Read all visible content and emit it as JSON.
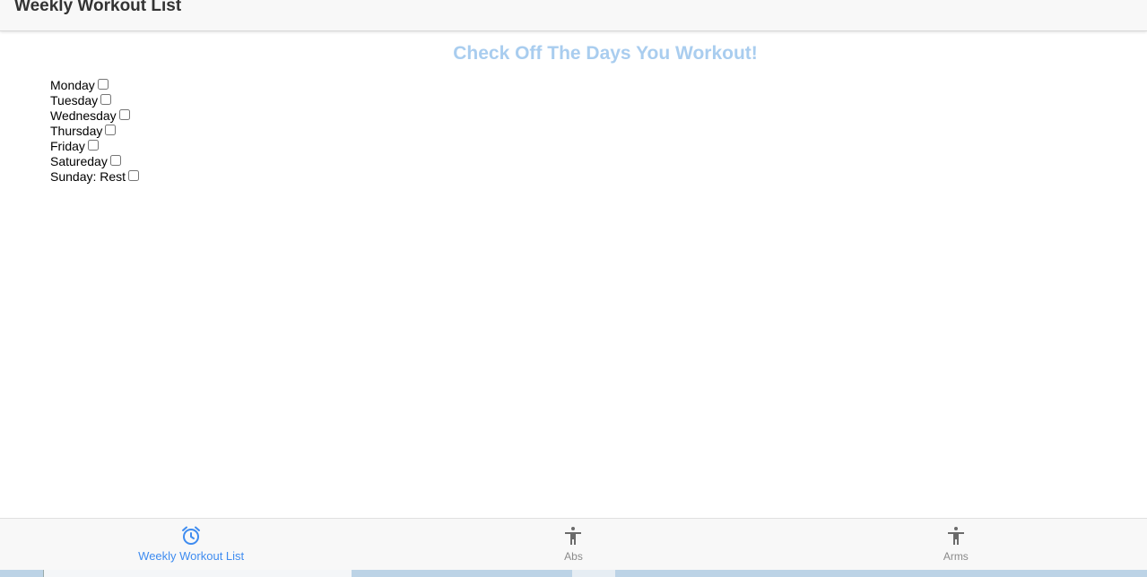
{
  "header": {
    "title": "Weekly Workout List"
  },
  "main": {
    "heading": "Check Off The Days You Workout!",
    "days": [
      {
        "label": "Monday",
        "checked": false
      },
      {
        "label": "Tuesday",
        "checked": false
      },
      {
        "label": "Wednesday",
        "checked": false
      },
      {
        "label": "Thursday",
        "checked": false
      },
      {
        "label": "Friday",
        "checked": false
      },
      {
        "label": "Satureday",
        "checked": false
      },
      {
        "label": "Sunday: Rest",
        "checked": false
      }
    ]
  },
  "tabs": [
    {
      "label": "Weekly Workout List",
      "icon": "alarm-clock-icon",
      "active": true
    },
    {
      "label": "Abs",
      "icon": "person-icon",
      "active": false
    },
    {
      "label": "Arms",
      "icon": "person-icon",
      "active": false
    }
  ],
  "colors": {
    "accent": "#3f8cf0",
    "heading": "#a9cdef",
    "inactive_tab": "#8a8a8a",
    "icon_gray": "#6b6b6b"
  }
}
